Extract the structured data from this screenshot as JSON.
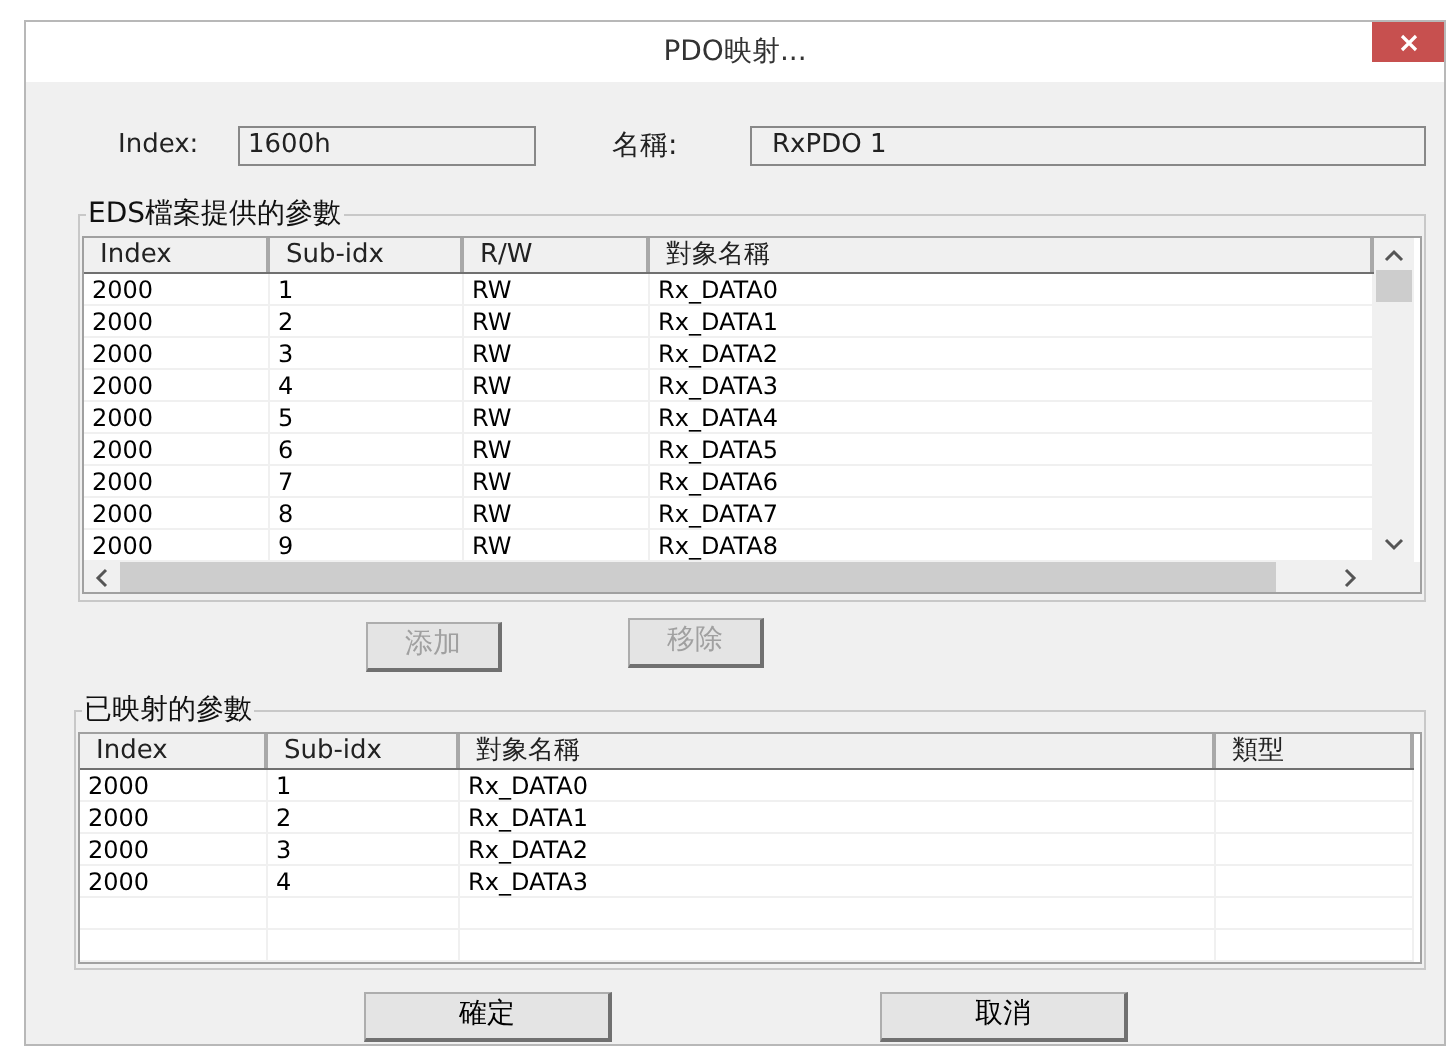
{
  "window": {
    "title": "PDO映射..."
  },
  "index": {
    "label": "Index:",
    "value": "1600h"
  },
  "name": {
    "label": "名稱:",
    "value": "RxPDO 1"
  },
  "eds_group": {
    "title": "EDS檔案提供的參數",
    "columns": [
      "Index",
      "Sub-idx",
      "R/W",
      "對象名稱"
    ],
    "rows": [
      [
        "2000",
        "1",
        "RW",
        "Rx_DATA0"
      ],
      [
        "2000",
        "2",
        "RW",
        "Rx_DATA1"
      ],
      [
        "2000",
        "3",
        "RW",
        "Rx_DATA2"
      ],
      [
        "2000",
        "4",
        "RW",
        "Rx_DATA3"
      ],
      [
        "2000",
        "5",
        "RW",
        "Rx_DATA4"
      ],
      [
        "2000",
        "6",
        "RW",
        "Rx_DATA5"
      ],
      [
        "2000",
        "7",
        "RW",
        "Rx_DATA6"
      ],
      [
        "2000",
        "8",
        "RW",
        "Rx_DATA7"
      ],
      [
        "2000",
        "9",
        "RW",
        "Rx_DATA8"
      ]
    ]
  },
  "middle_buttons": [
    {
      "label": "添加",
      "disabled": true
    },
    {
      "label": "移除",
      "disabled": true
    }
  ],
  "mapped_group": {
    "title": "已映射的參數",
    "columns": [
      "Index",
      "Sub-idx",
      "對象名稱",
      "類型"
    ],
    "rows": [
      [
        "2000",
        "1",
        "Rx_DATA0",
        ""
      ],
      [
        "2000",
        "2",
        "Rx_DATA1",
        ""
      ],
      [
        "2000",
        "3",
        "Rx_DATA2",
        ""
      ],
      [
        "2000",
        "4",
        "Rx_DATA3",
        ""
      ]
    ]
  },
  "buttons": [
    "確定",
    "取消"
  ]
}
